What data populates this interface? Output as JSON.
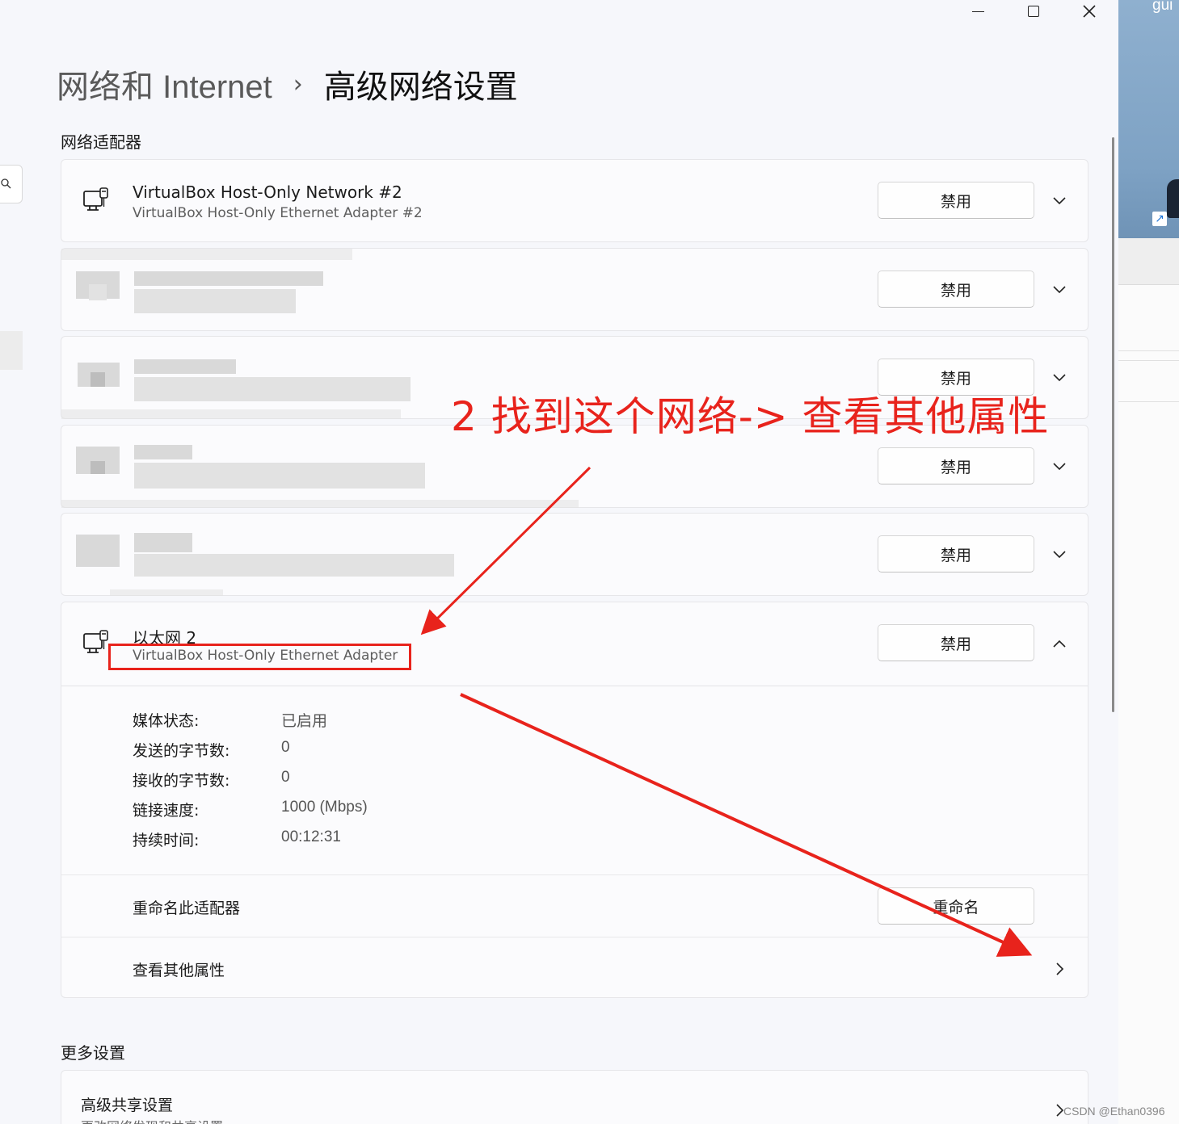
{
  "window": {
    "breadcrumb_parent": "网络和 Internet",
    "breadcrumb_separator": "›",
    "page_title": "高级网络设置"
  },
  "sections": {
    "adapters_title": "网络适配器",
    "more_title": "更多设置"
  },
  "adapters": [
    {
      "name": "VirtualBox Host-Only Network #2",
      "description": "VirtualBox Host-Only Ethernet Adapter #2",
      "button": "禁用",
      "expanded": false,
      "obscured": false
    },
    {
      "name": "",
      "description": "",
      "button": "禁用",
      "expanded": false,
      "obscured": true
    },
    {
      "name": "",
      "description": "",
      "button": "禁用",
      "expanded": false,
      "obscured": true
    },
    {
      "name": "",
      "description": "",
      "button": "禁用",
      "expanded": false,
      "obscured": true
    },
    {
      "name": "",
      "description": "",
      "button": "禁用",
      "expanded": false,
      "obscured": true
    },
    {
      "name": "以太网 2",
      "description": "VirtualBox Host-Only Ethernet Adapter",
      "button": "禁用",
      "expanded": true,
      "obscured": false
    }
  ],
  "details": [
    {
      "label": "媒体状态:",
      "value": "已启用"
    },
    {
      "label": "发送的字节数:",
      "value": "0"
    },
    {
      "label": "接收的字节数:",
      "value": "0"
    },
    {
      "label": "链接速度:",
      "value": "1000 (Mbps)"
    },
    {
      "label": "持续时间:",
      "value": "00:12:31"
    }
  ],
  "rename_row": {
    "label": "重命名此适配器",
    "button": "重命名"
  },
  "properties_row": {
    "label": "查看其他属性"
  },
  "more_settings": {
    "title": "高级共享设置",
    "subtitle": "更改网络发现和共享设置"
  },
  "annotation": {
    "text": "2 找到这个网络-> 查看其他属性",
    "color": "#e8231c"
  },
  "desktop": {
    "label": "gui"
  },
  "watermark": "CSDN @Ethan0396",
  "colors": {
    "window_bg": "#f6f7fb",
    "card_bg": "#fbfbfd",
    "annotation_red": "#e8231c"
  }
}
